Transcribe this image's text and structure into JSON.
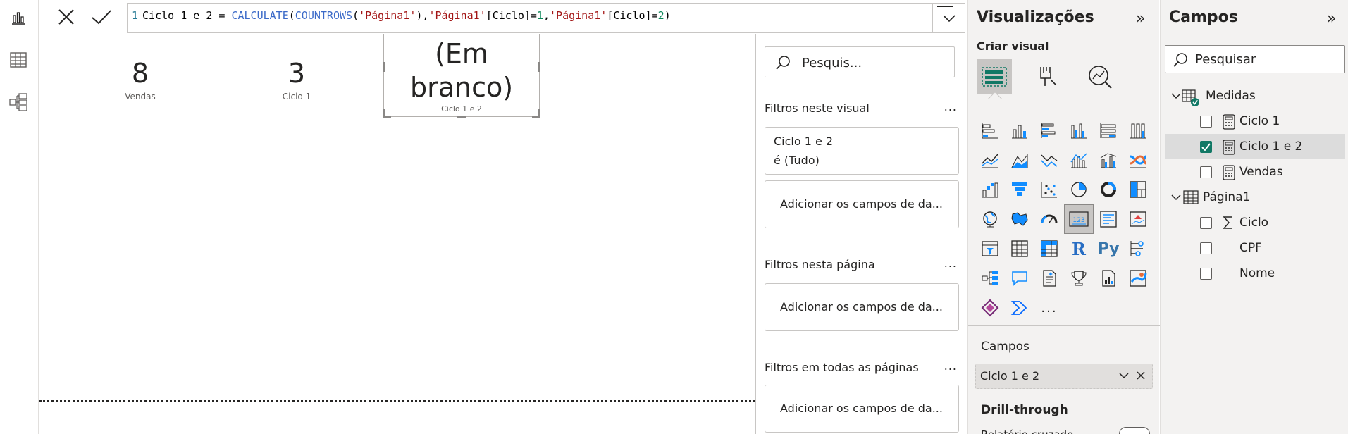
{
  "formula": {
    "line_number": "1",
    "p1": "Ciclo 1 e 2 = ",
    "fn1": "CALCULATE",
    "p2": "(",
    "fn2": "COUNTROWS",
    "p3": "(",
    "s1": "'Página1'",
    "p4": "),",
    "s2": "'Página1'",
    "p5": "[Ciclo]=",
    "n1": "1",
    "p6": ",",
    "s3": "'Página1'",
    "p7": "[Ciclo]=",
    "n2": "2",
    "p8": ")"
  },
  "canvas": {
    "cards": [
      {
        "value": "8",
        "label": "Vendas"
      },
      {
        "value": "3",
        "label": "Ciclo 1"
      }
    ],
    "selected_card": {
      "value_line1": "(Em",
      "value_line2": "branco)",
      "label": "Ciclo 1 e 2"
    }
  },
  "filters": {
    "search_placeholder": "Pesquis...",
    "more": "...",
    "sections": [
      {
        "title": "Filtros neste visual"
      },
      {
        "title": "Filtros nesta página"
      },
      {
        "title": "Filtros em todas as páginas"
      }
    ],
    "visual_filter": {
      "field": "Ciclo 1 e 2",
      "condition": "é (Tudo)"
    },
    "add_fields": "Adicionar os campos de da..."
  },
  "viz": {
    "title": "Visualizações",
    "collapse": "»",
    "build_visual": "Criar visual",
    "fields_label": "Campos",
    "field_chip": "Ciclo 1 e 2",
    "drill_through": "Drill-through",
    "partial_text": "Relatório cruzado",
    "r_label": "R",
    "py_label": "Py",
    "more": "..."
  },
  "fields_pane": {
    "title": "Campos",
    "collapse": "»",
    "search_placeholder": "Pesquisar",
    "tables": [
      {
        "name": "Medidas",
        "items": [
          "Ciclo 1",
          "Ciclo 1 e 2",
          "Vendas"
        ]
      },
      {
        "name": "Página1",
        "items": [
          "Ciclo",
          "CPF",
          "Nome"
        ]
      }
    ]
  },
  "colors": {
    "accent": "#117865",
    "report_icon": "#252423",
    "viz_blue": "#118dff"
  }
}
